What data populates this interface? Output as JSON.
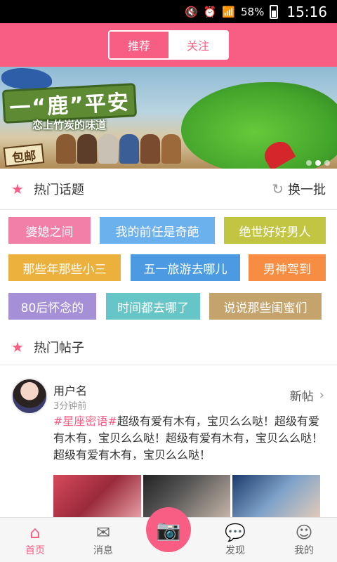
{
  "statusbar": {
    "battery": "58%",
    "time": "15:16"
  },
  "header": {
    "tabs": [
      {
        "label": "推荐"
      },
      {
        "label": "关注"
      }
    ]
  },
  "banner": {
    "title": "一“鹿”平安",
    "subtitle": "恋上竹炭的味道",
    "badge": "包邮",
    "slide_count": 3,
    "active_slide": 1
  },
  "hot_topics": {
    "title": "热门话题",
    "refresh_label": "换一批",
    "tags": [
      {
        "label": "婆媳之间",
        "color": "#f27fa8"
      },
      {
        "label": "我的前任是奇葩",
        "color": "#6ab1ee"
      },
      {
        "label": "绝世好好男人",
        "color": "#c2c541"
      },
      {
        "label": "那些年那些小三",
        "color": "#ecb13c"
      },
      {
        "label": "五一旅游去哪儿",
        "color": "#4c9be2"
      },
      {
        "label": "男神驾到",
        "color": "#f68d43"
      },
      {
        "label": "80后怀念的",
        "color": "#a58fd6"
      },
      {
        "label": "时间都去哪了",
        "color": "#66c6c7"
      },
      {
        "label": "说说那些闺蜜们",
        "color": "#c4a36d"
      }
    ]
  },
  "hot_posts": {
    "title": "热门帖子",
    "post": {
      "username": "用户名",
      "time": "3分钟前",
      "badge": "新帖",
      "topic": "#星座密语#",
      "text": "超级有爱有木有，宝贝么么哒！超级有爱有木有，宝贝么么哒！超级有爱有木有，宝贝么么哒！超级有爱有木有，宝贝么么哒！"
    }
  },
  "tabbar": {
    "items": [
      {
        "label": "首页"
      },
      {
        "label": "消息"
      },
      {
        "label": "发现"
      },
      {
        "label": "我的"
      }
    ]
  }
}
